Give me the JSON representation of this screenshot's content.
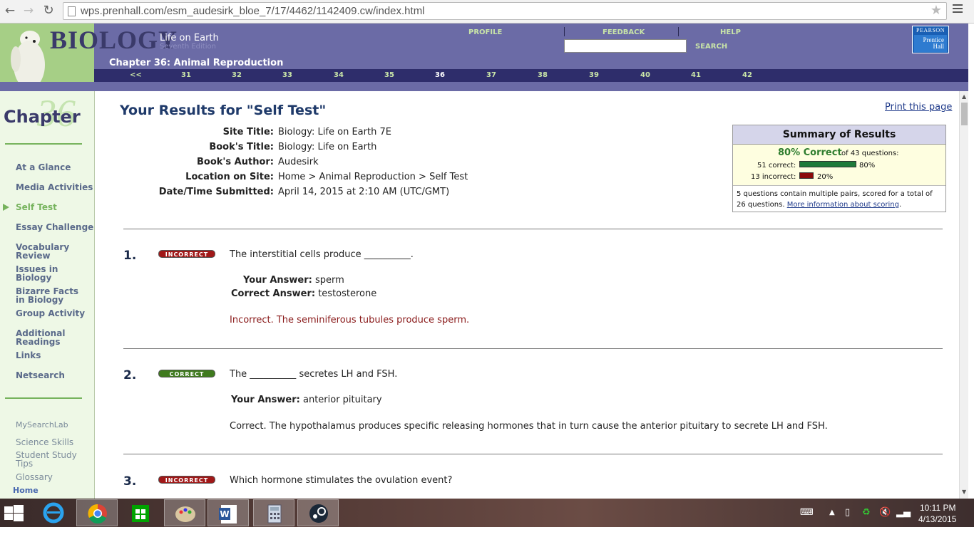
{
  "browser": {
    "url": "wps.prenhall.com/esm_audesirk_bloe_7/17/4462/1142409.cw/index.html"
  },
  "header": {
    "logo": "BIOLOGY",
    "logo_sub1": "Life on Earth",
    "logo_sub2": "Seventh Edition",
    "links": [
      "PROFILE",
      "FEEDBACK",
      "HELP"
    ],
    "search_label": "SEARCH",
    "search_value": "",
    "pearson_top": "PEARSON",
    "pearson_sub1": "Prentice",
    "pearson_sub2": "Hall",
    "chapter_title": "Chapter 36: Animal Reproduction",
    "chapter_nav_prev": "<<",
    "chapters": [
      "31",
      "32",
      "33",
      "34",
      "35",
      "36",
      "37",
      "38",
      "39",
      "40",
      "41",
      "42"
    ],
    "current_chapter": "36"
  },
  "sidebar": {
    "chapter_word": "Chapter",
    "chapter_number": "36",
    "items": [
      {
        "label": "At a Glance",
        "active": false
      },
      {
        "label": "Media Activities",
        "active": false
      },
      {
        "label": "Self Test",
        "active": true
      },
      {
        "label": "Essay Challenge",
        "active": false
      },
      {
        "label": "Vocabulary\nReview",
        "active": false
      },
      {
        "label": "Issues in\nBiology",
        "active": false
      },
      {
        "label": "Bizarre Facts\nin Biology",
        "active": false
      },
      {
        "label": "Group Activity",
        "active": false
      },
      {
        "label": "Additional\nReadings",
        "active": false
      },
      {
        "label": "Links",
        "active": false
      },
      {
        "label": "Netsearch",
        "active": false
      }
    ],
    "secondary": [
      "MySearchLab",
      "Science Skills",
      "Student Study\nTips",
      "Glossary"
    ],
    "home": "Home"
  },
  "main": {
    "title": "Your Results for \"Self Test\"",
    "print": "Print this page",
    "meta": [
      {
        "label": "Site Title:",
        "value": "Biology: Life on Earth 7E"
      },
      {
        "label": "Book's Title:",
        "value": "Biology: Life on Earth"
      },
      {
        "label": "Book's Author:",
        "value": "Audesirk"
      },
      {
        "label": "Location on Site:",
        "value": "Home > Animal Reproduction > Self Test"
      },
      {
        "label": "Date/Time Submitted:",
        "value": "April 14, 2015 at 2:10 AM (UTC/GMT)"
      }
    ],
    "summary": {
      "title": "Summary of Results",
      "percent": "80% Correct",
      "of_text": "of 43 questions:",
      "correct_label": "51 correct:",
      "correct_pct": "80%",
      "correct_fraction": 0.8,
      "incorrect_label": "13 incorrect:",
      "incorrect_pct": "20%",
      "incorrect_fraction": 0.2,
      "note": "5 questions contain multiple pairs, scored for a total of 26 questions.",
      "more_info": "More information about scoring",
      "colors": {
        "correct": "#1e7a3a",
        "incorrect": "#8a0a0a"
      }
    },
    "questions": [
      {
        "number": "1.",
        "status": "INCORRECT",
        "text": "The interstitial cells produce __________.",
        "your_answer_label": "Your Answer:",
        "your_answer": "sperm",
        "correct_answer_label": "Correct Answer:",
        "correct_answer": "testosterone",
        "feedback": "Incorrect. The seminiferous tubules produce sperm."
      },
      {
        "number": "2.",
        "status": "CORRECT",
        "text": "The __________ secretes LH and FSH.",
        "your_answer_label": "Your Answer:",
        "your_answer": "anterior pituitary",
        "feedback": "Correct. The hypothalamus produces specific releasing hormones that in turn cause the anterior pituitary to secrete LH and FSH."
      },
      {
        "number": "3.",
        "status": "INCORRECT",
        "text": "Which hormone stimulates the ovulation event?"
      }
    ]
  },
  "taskbar": {
    "apps": [
      "start-icon",
      "ie-icon",
      "chrome-icon",
      "store-icon",
      "paint-icon",
      "word-icon",
      "calculator-icon",
      "steam-icon"
    ],
    "time": "10:11 PM",
    "date": "4/13/2015"
  }
}
